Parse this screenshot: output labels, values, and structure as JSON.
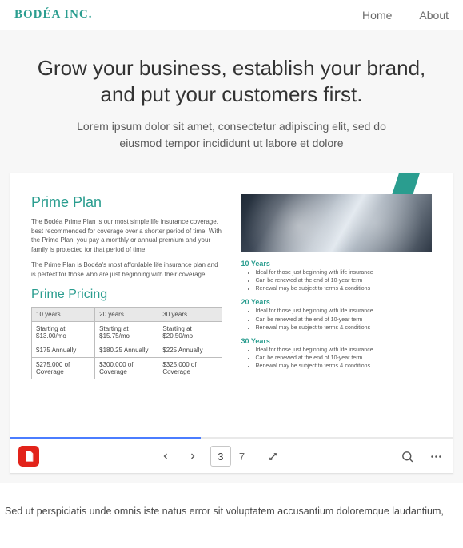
{
  "header": {
    "brand": "BODÉA INC.",
    "nav": {
      "home": "Home",
      "about": "About"
    }
  },
  "hero": {
    "title": "Grow your business, establish your brand, and put your customers first.",
    "subtitle": "Lorem ipsum dolor sit amet, consectetur adipiscing elit, sed do eiusmod tempor incididunt ut labore et dolore"
  },
  "doc": {
    "plan_heading": "Prime Plan",
    "plan_p1": "The Bodéa Prime Plan is our most simple life insurance coverage, best recommended for coverage over a shorter period of time. With the Prime Plan, you pay a monthly or annual premium and your family is protected for that period of time.",
    "plan_p2": "The Prime Plan is Bodéa's most affordable life insurance plan and is perfect for those who are just beginning with their coverage.",
    "pricing_heading": "Prime Pricing",
    "table": {
      "headers": [
        "10 years",
        "20 years",
        "30 years"
      ],
      "rows": [
        [
          "Starting at $13.00/mo",
          "Starting at $15.75/mo",
          "Starting at $20.50/mo"
        ],
        [
          "$175 Annually",
          "$180.25 Annually",
          "$225 Annually"
        ],
        [
          "$275,000 of Coverage",
          "$300,000 of Coverage",
          "$325,000 of Coverage"
        ]
      ]
    },
    "terms": [
      {
        "title": "10 Years",
        "items": [
          "Ideal for those just beginning with life insurance",
          "Can be renewed at the end of 10-year term",
          "Renewal may be subject to terms & conditions"
        ]
      },
      {
        "title": "20 Years",
        "items": [
          "Ideal for those just beginning with life insurance",
          "Can be renewed at the end of 10-year term",
          "Renewal may be subject to terms & conditions"
        ]
      },
      {
        "title": "30 Years",
        "items": [
          "Ideal for those just beginning with life insurance",
          "Can be renewed at the end of 10-year term",
          "Renewal may be subject to terms & conditions"
        ]
      }
    ]
  },
  "toolbar": {
    "current_page": "3",
    "total_pages": "7"
  },
  "footer": {
    "text": "Sed ut perspiciatis unde omnis iste natus error sit voluptatem accusantium doloremque laudantium,"
  }
}
